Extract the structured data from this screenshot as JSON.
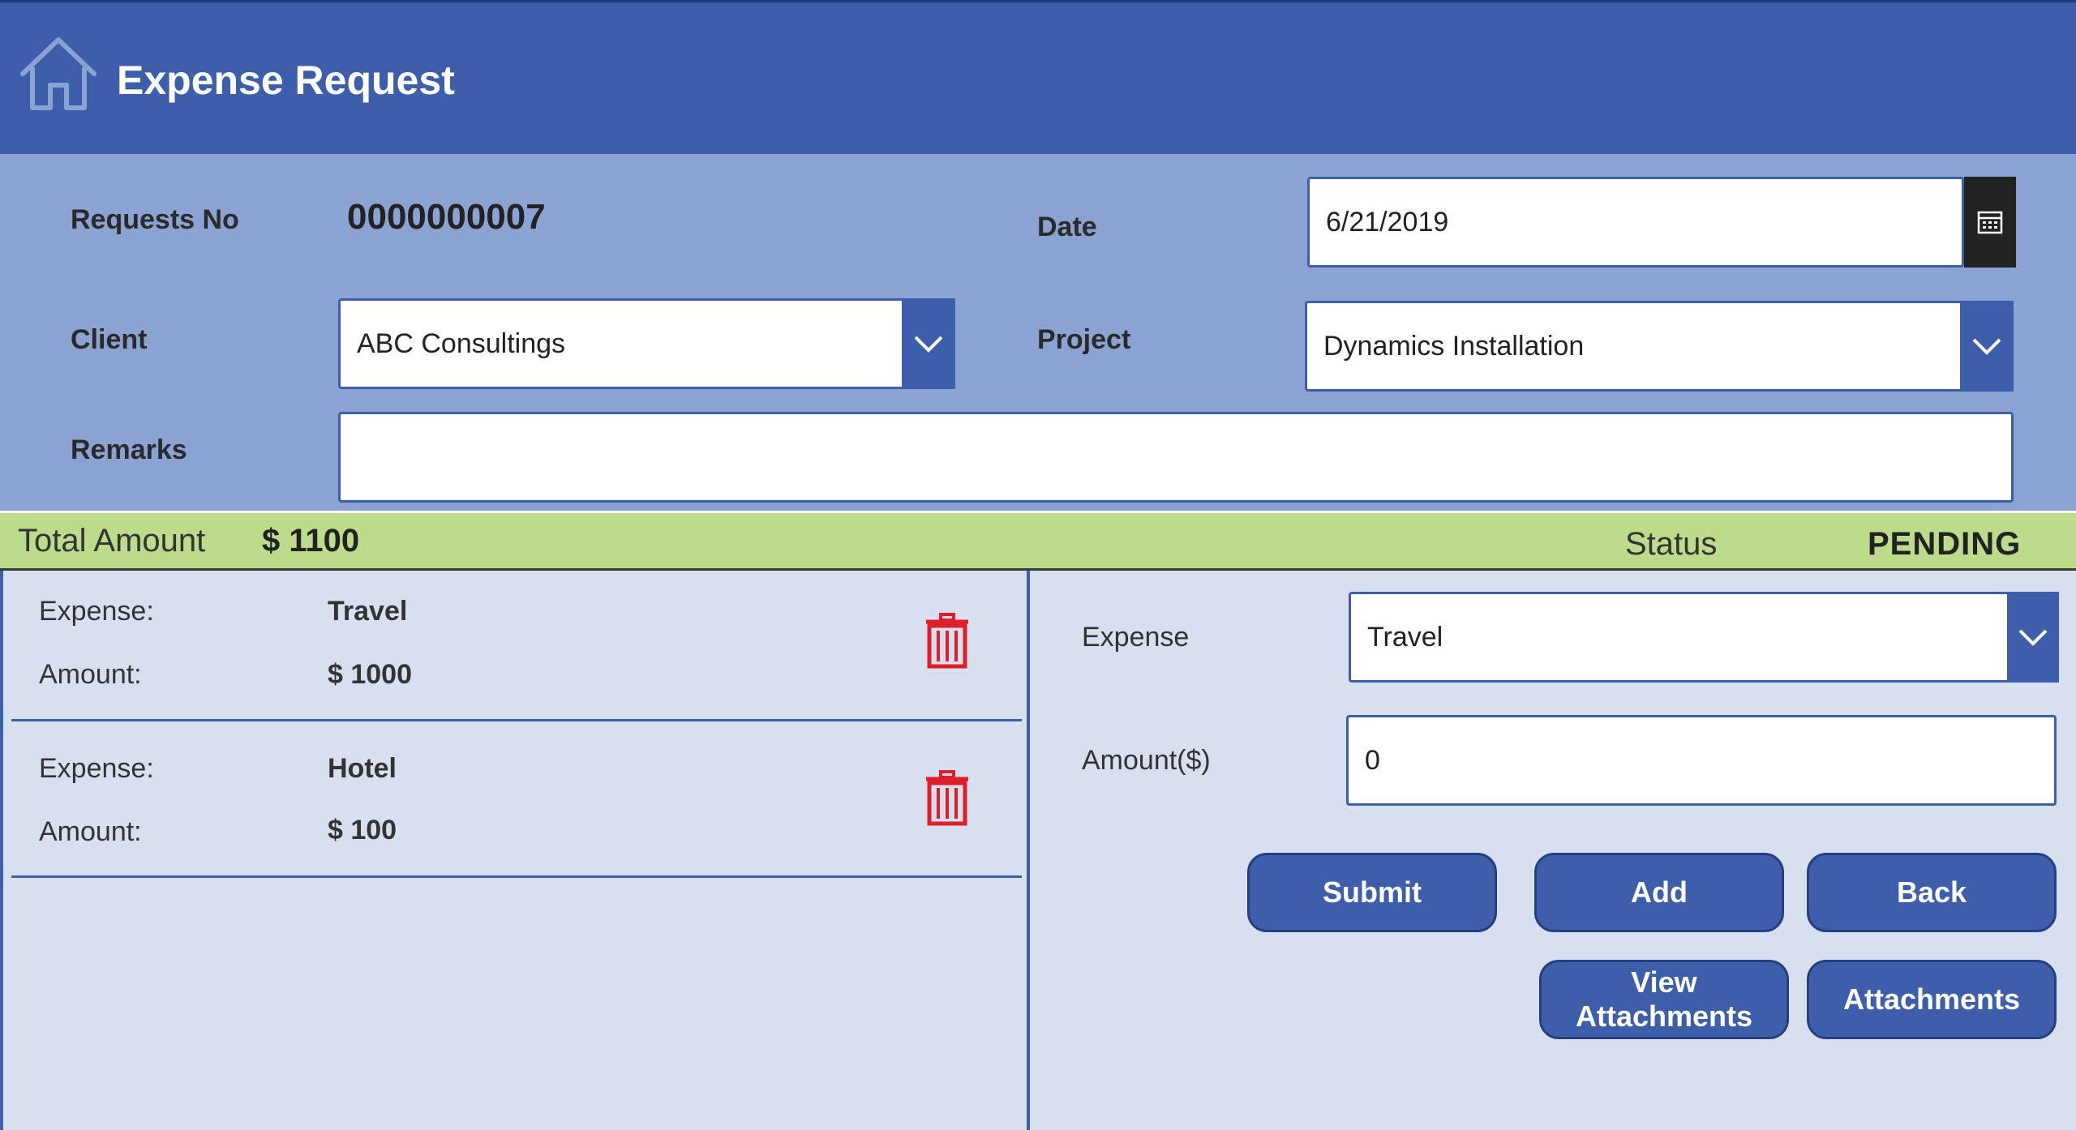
{
  "header": {
    "title": "Expense Request",
    "bg_color": "#3d5fab"
  },
  "form": {
    "request_no_label": "Requests No",
    "request_no_value": "0000000007",
    "date_label": "Date",
    "date_value": "6/21/2019",
    "client_label": "Client",
    "client_value": "ABC Consultings",
    "project_label": "Project",
    "project_value": "Dynamics Installation",
    "remarks_label": "Remarks",
    "remarks_value": ""
  },
  "summary": {
    "total_label": "Total Amount",
    "total_value": "$ 1100",
    "status_label": "Status",
    "status_value": "PENDING",
    "bar_color": "#bcdc8c"
  },
  "expenses": [
    {
      "expense_label": "Expense:",
      "expense_value": "Travel",
      "amount_label": "Amount:",
      "amount_value": "$ 1000"
    },
    {
      "expense_label": "Expense:",
      "expense_value": "Hotel",
      "amount_label": "Amount:",
      "amount_value": "$ 100"
    }
  ],
  "detail": {
    "expense_label": "Expense",
    "expense_value": "Travel",
    "amount_label": "Amount($)",
    "amount_value": "0"
  },
  "buttons": {
    "submit": "Submit",
    "add": "Add",
    "back": "Back",
    "view_attachments_line1": "View",
    "view_attachments_line2": "Attachments",
    "attachments": "Attachments"
  },
  "icons": {
    "home": "home-icon",
    "calendar": "calendar-icon",
    "dropdown": "chevron-down-icon",
    "delete": "trash-icon"
  },
  "colors": {
    "accent": "#3d5fab",
    "delete_icon": "#e01e2a"
  }
}
